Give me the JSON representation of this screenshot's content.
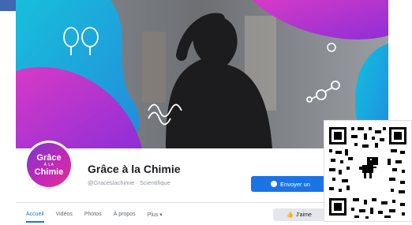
{
  "page": {
    "name": "Grâce à la Chimie",
    "handle": "@Graceslachimie · Scientifique"
  },
  "profile_picture": {
    "line1": "Grâce",
    "line2": "À LA",
    "line3": "Chimie"
  },
  "actions": {
    "send_message_label": "Envoyer un",
    "like_label": "J'aime"
  },
  "tabs": [
    {
      "label": "Accueil",
      "active": true
    },
    {
      "label": "Vidéos",
      "active": false
    },
    {
      "label": "Photos",
      "active": false
    },
    {
      "label": "À propos",
      "active": false
    },
    {
      "label": "Plus ▾",
      "active": false
    }
  ],
  "icons": {
    "messenger": "messenger-icon",
    "thumbs_up": "thumbs-up-icon",
    "qr": "qr-code",
    "dino": "dino-icon"
  },
  "colors": {
    "accent": "#1b74e4",
    "cyan": "#24c8e0",
    "magenta": "#c83cd0",
    "purple": "#7a39c9"
  }
}
